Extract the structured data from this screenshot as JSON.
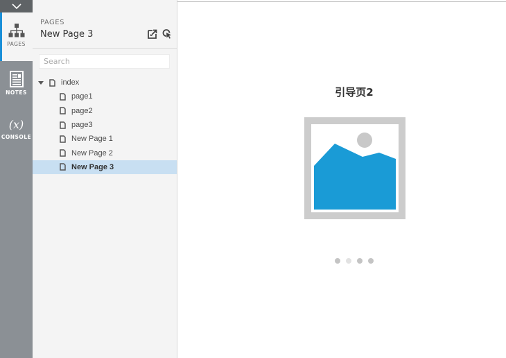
{
  "rail": {
    "tabs": [
      {
        "id": "pages",
        "label": "PAGES",
        "icon": "sitemap-icon",
        "active": true
      },
      {
        "id": "notes",
        "label": "NOTES",
        "icon": "notes-icon",
        "active": false
      },
      {
        "id": "console",
        "label": "CONSOLE",
        "icon": "fx-icon",
        "glyph": "(x)",
        "active": false
      }
    ]
  },
  "panel": {
    "section_label": "PAGES",
    "current_page": "New Page 3",
    "search_placeholder": "Search",
    "search_value": "",
    "tree": [
      {
        "label": "index",
        "level": 0,
        "expanded": true,
        "selected": false
      },
      {
        "label": "page1",
        "level": 1,
        "selected": false
      },
      {
        "label": "page2",
        "level": 1,
        "selected": false
      },
      {
        "label": "page3",
        "level": 1,
        "selected": false
      },
      {
        "label": "New Page 1",
        "level": 1,
        "selected": false
      },
      {
        "label": "New Page 2",
        "level": 1,
        "selected": false
      },
      {
        "label": "New Page 3",
        "level": 1,
        "selected": true
      }
    ]
  },
  "canvas": {
    "heading": "引导页2",
    "carousel": {
      "dot_count": 4,
      "dot_colors": [
        "#c4c4c4",
        "#e2e2e2",
        "#c4c4c4",
        "#c4c4c4"
      ]
    }
  },
  "colors": {
    "accent": "#1a8fd8",
    "selection": "#c8dff2",
    "image_blue": "#1a9bd6",
    "image_frame": "#cccccc"
  }
}
